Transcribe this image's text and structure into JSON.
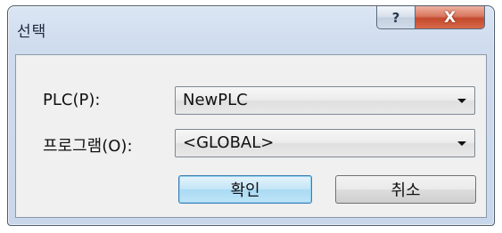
{
  "window": {
    "title": "선택",
    "help_button": "?",
    "close_button": "X"
  },
  "form": {
    "plc_label": "PLC(P):",
    "plc_value": "NewPLC",
    "program_label": "프로그램(O):",
    "program_value": "<GLOBAL>"
  },
  "buttons": {
    "ok_label": "확인",
    "cancel_label": "취소"
  },
  "icons": {
    "dropdown": "chevron-down-icon",
    "help": "help-icon",
    "close": "close-icon"
  }
}
